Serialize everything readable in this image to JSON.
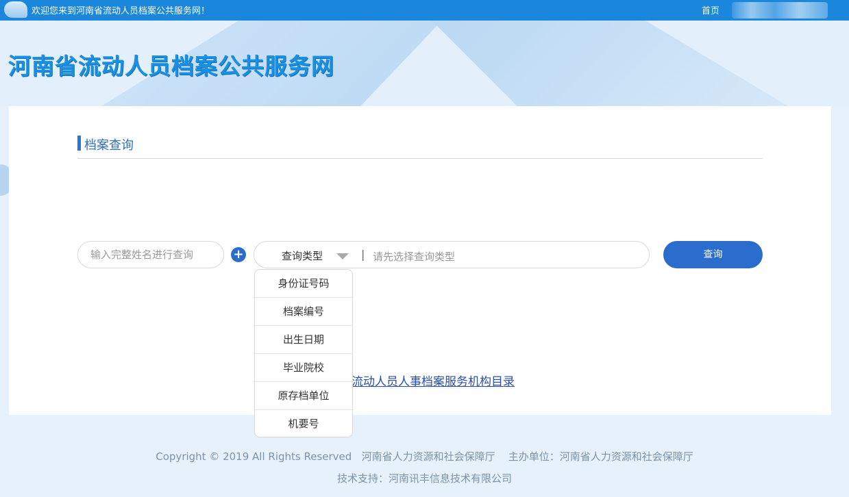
{
  "topbar": {
    "welcome": "欢迎您来到河南省流动人员档案公共服务网！",
    "home": "首页"
  },
  "header": {
    "site_title": "河南省流动人员档案公共服务网"
  },
  "section": {
    "title": "档案查询"
  },
  "search": {
    "name_placeholder": "输入完整姓名进行查询",
    "add_label": "+",
    "type_label": "查询类型",
    "separator": "|",
    "type_value": "请先选择查询类型",
    "query_button": "查询"
  },
  "dropdown": {
    "options": [
      "身份证号码",
      "档案编号",
      "出生日期",
      "毕业院校",
      "原存档单位",
      "机要号"
    ]
  },
  "links": {
    "directory": "流动人员人事档案服务机构目录"
  },
  "footer": {
    "copyright": "Copyright © 2019 All Rights Reserved",
    "org": "河南省人力资源和社会保障厅",
    "host": "主办单位：河南省人力资源和社会保障厅",
    "tech": "技术支持：河南讯丰信息技术有限公司"
  }
}
